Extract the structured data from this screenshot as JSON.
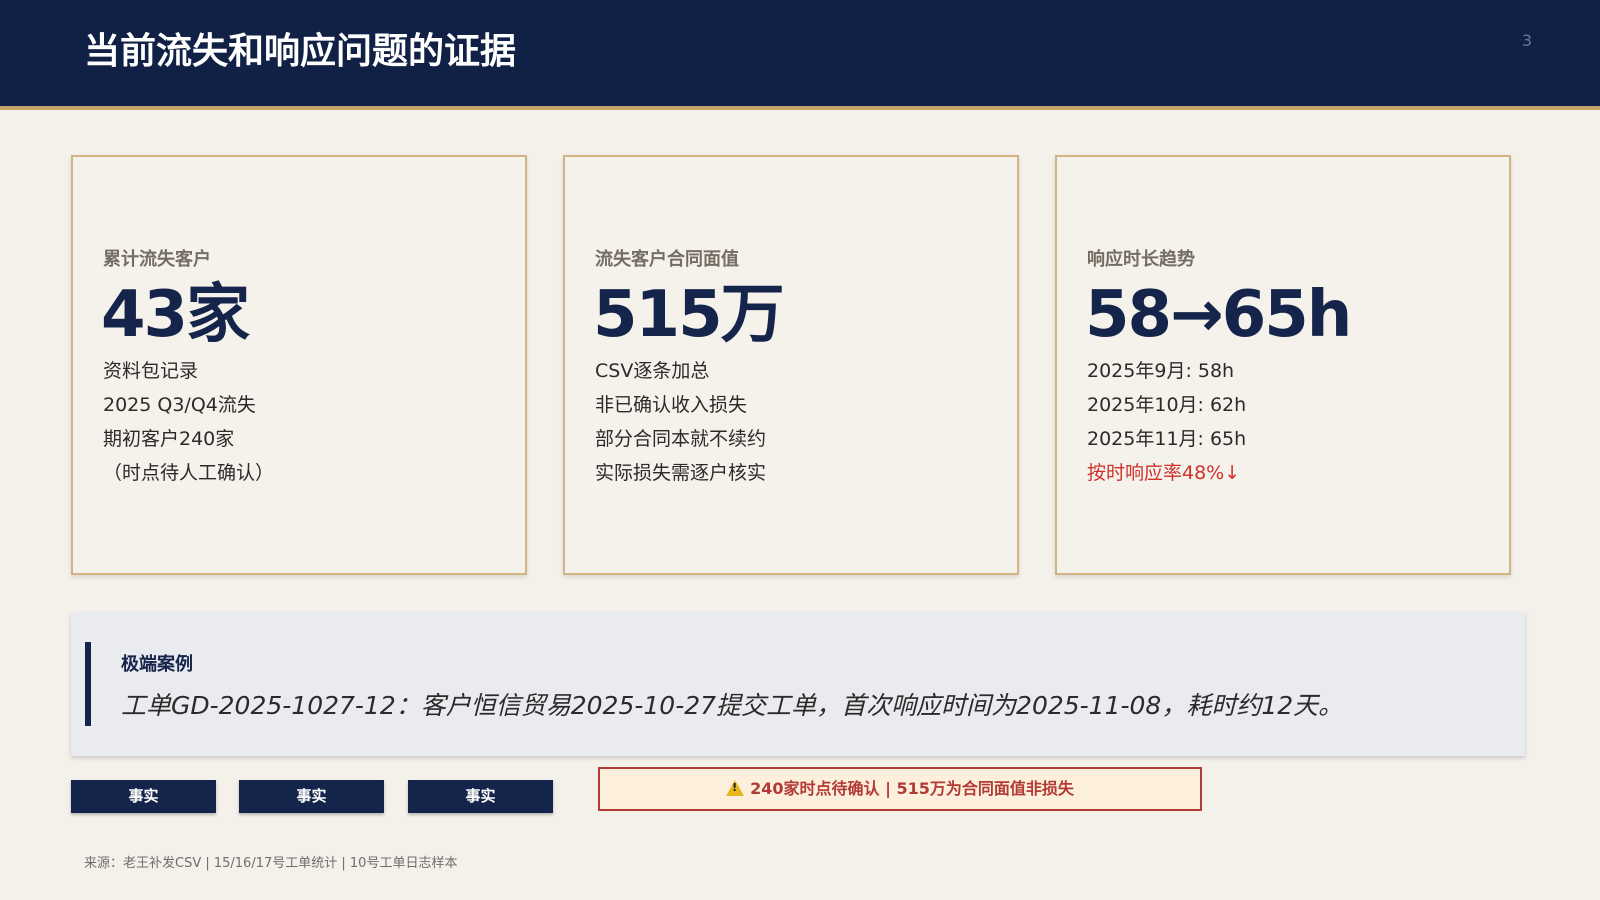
{
  "header": {
    "title": "当前流失和响应问题的证据",
    "page_number": "3"
  },
  "cards": [
    {
      "label": "累计流失客户",
      "value": "43家",
      "lines": [
        "资料包记录",
        "2025 Q3/Q4流失",
        "期初客户240家",
        "（时点待人工确认）"
      ]
    },
    {
      "label": "流失客户合同面值",
      "value": "515万",
      "lines": [
        "CSV逐条加总",
        "非已确认收入损失",
        "部分合同本就不续约",
        "实际损失需逐户核实"
      ]
    },
    {
      "label": "响应时长趋势",
      "value": "58→65h",
      "lines": [
        "2025年9月: 58h",
        "2025年10月: 62h",
        "2025年11月: 65h",
        "按时响应率48%↓"
      ]
    }
  ],
  "case": {
    "label": "极端案例",
    "text": "工单GD-2025-1027-12：客户恒信贸易2025-10-27提交工单，首次响应时间为2025-11-08，耗时约12天。"
  },
  "tags": [
    "事实",
    "事实",
    "事实"
  ],
  "warning": {
    "icon": "warning-icon",
    "text": "240家时点待确认 | 515万为合同面值非损失"
  },
  "source": "来源：老王补发CSV | 15/16/17号工单统计 | 10号工单日志样本",
  "colors": {
    "header_bg": "#112045",
    "accent_gold": "#c5a56b",
    "navy": "#15244a",
    "alert_red": "#d0312d",
    "background": "#f4f1ea"
  }
}
